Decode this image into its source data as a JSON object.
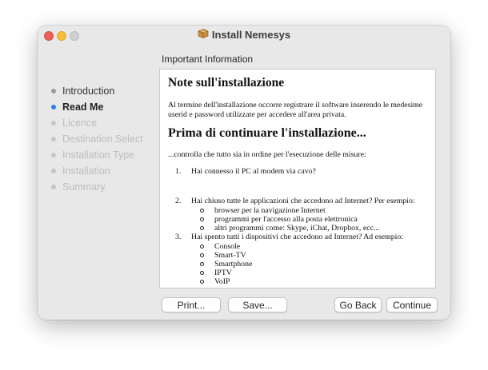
{
  "window": {
    "title": "Install Nemesys",
    "icon": "package-icon"
  },
  "section_heading": "Important Information",
  "steps": [
    {
      "label": "Introduction",
      "state": "done"
    },
    {
      "label": "Read Me",
      "state": "current"
    },
    {
      "label": "Licence",
      "state": "pending"
    },
    {
      "label": "Destination Select",
      "state": "pending"
    },
    {
      "label": "Installation Type",
      "state": "pending"
    },
    {
      "label": "Installation",
      "state": "pending"
    },
    {
      "label": "Summary",
      "state": "pending"
    }
  ],
  "document": {
    "heading1": "Note sull'installazione",
    "para1": "Al termine dell'installazione occorre registrare il software inserendo le medesime userid e password utilizzate per accedere all'area privata.",
    "heading2": "Prima di continuare l'installazione...",
    "intro": "...controlla che tutto sia in ordine per l'esecuzione delle misure:",
    "items": [
      {
        "num": "1.",
        "text": "Hai connesso il PC al modem via cavo?",
        "sub": []
      },
      {
        "num": "2.",
        "text": "Hai chiuso tutte le applicazioni che accedono ad Internet? Per esempio:",
        "sub": [
          "browser per la navigazione Internet",
          "programmi per l'accesso alla posta elettronica",
          "altri programmi come: Skype, iChat, Dropbox, ecc..."
        ]
      },
      {
        "num": "3.",
        "text": "Hai spento tutti i dispositivi che accedono ad Internet? Ad esempio:",
        "sub": [
          "Console",
          "Smart-TV",
          "Smartphone",
          "IPTV",
          "VoIP"
        ]
      }
    ]
  },
  "buttons": {
    "print": "Print...",
    "save": "Save...",
    "back": "Go Back",
    "continue": "Continue"
  },
  "colors": {
    "window_bg": "#e9e8e8",
    "accent_dot": "#2a7de1",
    "close": "#ec5f57",
    "minimize": "#f5be3c",
    "zoom_inactive": "#d2d1d1"
  }
}
